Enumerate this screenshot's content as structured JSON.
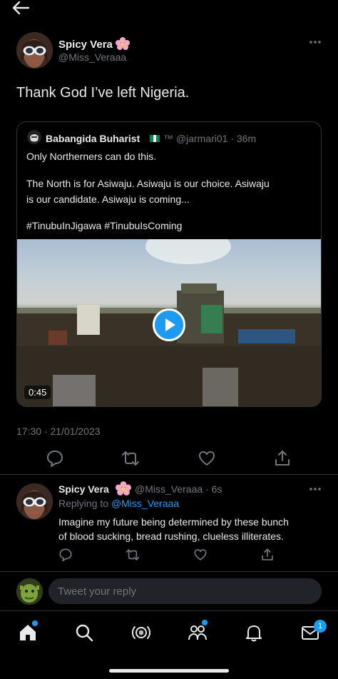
{
  "main_tweet": {
    "author_name": "Spicy Vera",
    "author_handle": "@Miss_Veraaa",
    "text": "Thank God I’ve left Nigeria.",
    "timestamp": "17:30 · 21/01/2023"
  },
  "quoted_tweet": {
    "author_name": "Babangida Buharist",
    "meta": "™  @jarmari01 · 36m",
    "lines": [
      "Only Northerners can do this.",
      "The North is for Asiwaju. Asiwaju is our choice. Asiwaju",
      "is our candidate. Asiwaju is coming...",
      "#TinubuInJigawa #TinubuIsComing"
    ],
    "video_duration": "0:45"
  },
  "reply": {
    "author_name": "Spicy Vera",
    "meta": "@Miss_Veraaa · 6s",
    "replying_prefix": "Replying to",
    "replying_handle": "@Miss_Veraaa",
    "lines": [
      "Imagine my future being determined by these bunch",
      "of blood sucking, bread rushing, clueless illiterates."
    ]
  },
  "compose": {
    "placeholder": "Tweet your reply"
  },
  "nav": {
    "messages_badge": "1"
  },
  "icons": {
    "back": "arrow-left-icon",
    "more": "more-horizontal-icon",
    "reply": "reply-icon",
    "retweet": "retweet-icon",
    "like": "heart-icon",
    "share": "share-icon",
    "play": "play-icon",
    "home": "home-icon",
    "search": "search-icon",
    "spaces": "spaces-icon",
    "communities": "communities-icon",
    "notifications": "bell-icon",
    "messages": "mail-icon"
  },
  "colors": {
    "background": "#000000",
    "text": "#e7e9ea",
    "muted": "#71767b",
    "accent": "#1d9bf0",
    "border": "#2f3336"
  }
}
